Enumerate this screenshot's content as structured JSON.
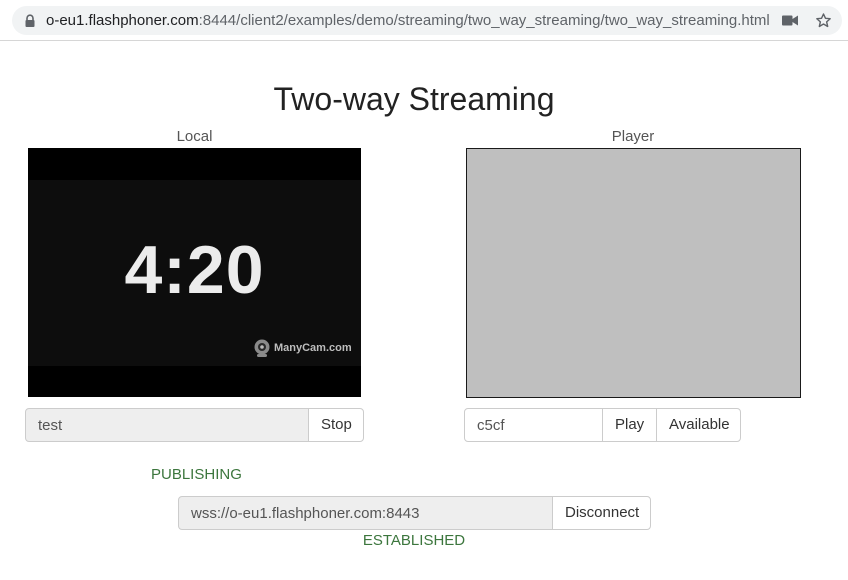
{
  "browser": {
    "url_host": "o-eu1.flashphoner.com",
    "url_path": ":8444/client2/examples/demo/streaming/two_way_streaming/two_way_streaming.html",
    "icons": [
      "lock-icon",
      "camera-icon",
      "star-icon"
    ]
  },
  "page": {
    "title": "Two-way Streaming"
  },
  "local": {
    "label": "Local",
    "video_clock": "4:20",
    "watermark": "ManyCam.com",
    "stream_name": "test",
    "stop_label": "Stop",
    "status": "PUBLISHING"
  },
  "player": {
    "label": "Player",
    "stream_name": "c5cf",
    "play_label": "Play",
    "available_label": "Available"
  },
  "connection": {
    "url": "wss://o-eu1.flashphoner.com:8443",
    "disconnect_label": "Disconnect",
    "status": "ESTABLISHED"
  },
  "colors": {
    "status_green": "#3c763d",
    "player_bg": "#bfbfbf",
    "readonly_bg": "#eeeeee"
  }
}
